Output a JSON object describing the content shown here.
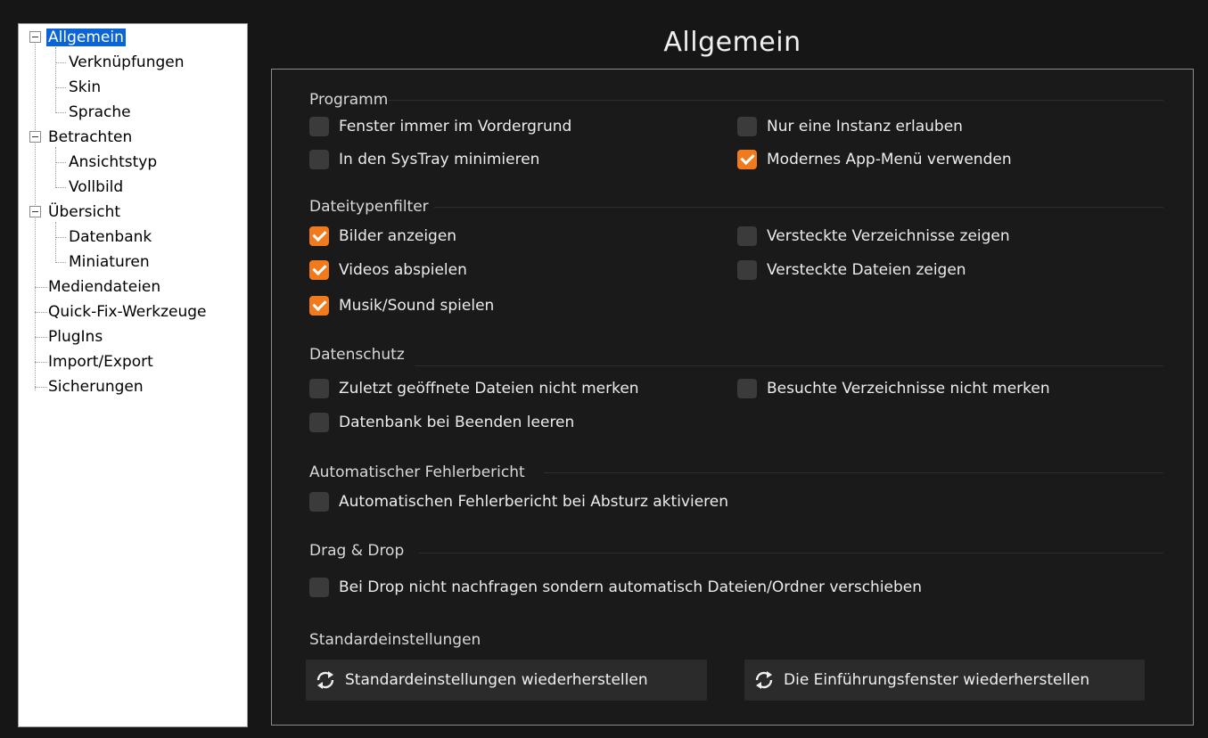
{
  "tree": {
    "items": [
      {
        "label": "Allgemein",
        "selected": true,
        "expanded": true
      },
      {
        "label": "Verknüpfungen"
      },
      {
        "label": "Skin"
      },
      {
        "label": "Sprache"
      },
      {
        "label": "Betrachten",
        "expanded": true
      },
      {
        "label": "Ansichtstyp"
      },
      {
        "label": "Vollbild"
      },
      {
        "label": "Übersicht",
        "expanded": true
      },
      {
        "label": "Datenbank"
      },
      {
        "label": "Miniaturen"
      },
      {
        "label": "Mediendateien"
      },
      {
        "label": "Quick-Fix-Werkzeuge"
      },
      {
        "label": "PlugIns"
      },
      {
        "label": "Import/Export"
      },
      {
        "label": "Sicherungen"
      }
    ]
  },
  "page": {
    "title": "Allgemein"
  },
  "sections": {
    "programm": {
      "title": "Programm",
      "options": [
        {
          "label": "Fenster immer im Vordergrund",
          "checked": false
        },
        {
          "label": "Nur eine Instanz erlauben",
          "checked": false
        },
        {
          "label": "In den SysTray minimieren",
          "checked": false
        },
        {
          "label": "Modernes App-Menü verwenden",
          "checked": true
        }
      ]
    },
    "dateityp": {
      "title": "Dateitypenfilter",
      "options": [
        {
          "label": "Bilder anzeigen",
          "checked": true
        },
        {
          "label": "Versteckte Verzeichnisse zeigen",
          "checked": false
        },
        {
          "label": "Videos abspielen",
          "checked": true
        },
        {
          "label": "Versteckte Dateien zeigen",
          "checked": false
        },
        {
          "label": "Musik/Sound spielen",
          "checked": true
        }
      ]
    },
    "datenschutz": {
      "title": "Datenschutz",
      "options": [
        {
          "label": "Zuletzt geöffnete Dateien nicht merken",
          "checked": false
        },
        {
          "label": "Besuchte Verzeichnisse nicht merken",
          "checked": false
        },
        {
          "label": "Datenbank bei Beenden leeren",
          "checked": false
        }
      ]
    },
    "fehlerbericht": {
      "title": "Automatischer Fehlerbericht",
      "options": [
        {
          "label": "Automatischen Fehlerbericht bei Absturz aktivieren",
          "checked": false
        }
      ]
    },
    "dragdrop": {
      "title": "Drag & Drop",
      "options": [
        {
          "label": "Bei Drop nicht nachfragen sondern automatisch Dateien/Ordner verschieben",
          "checked": false
        }
      ]
    },
    "standard": {
      "title": "Standardeinstellungen",
      "buttons": [
        {
          "label": "Standardeinstellungen wiederherstellen",
          "icon": "refresh-icon"
        },
        {
          "label": "Die Einführungsfenster wiederherstellen",
          "icon": "refresh-icon"
        }
      ]
    }
  },
  "colors": {
    "accent": "#f07a1c",
    "selection": "#0a64d6",
    "background": "#161616"
  }
}
